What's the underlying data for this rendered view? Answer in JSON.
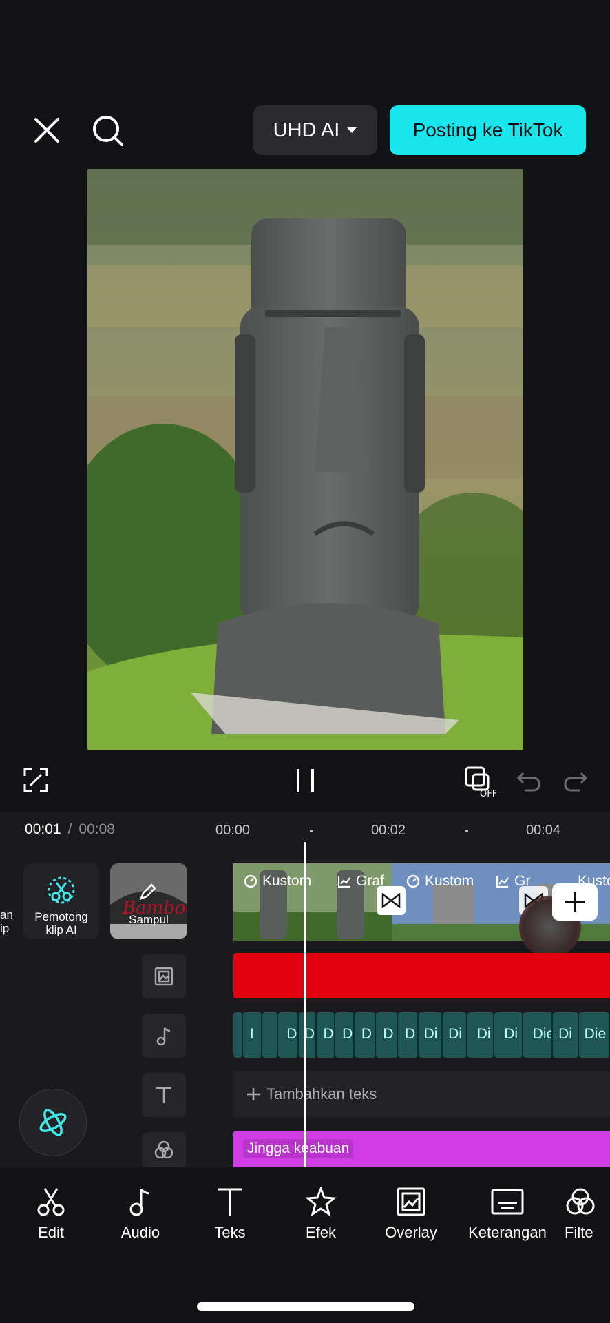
{
  "header": {
    "quality_label": "UHD AI",
    "post_label": "Posting ke TikTok"
  },
  "playback": {
    "current_time": "00:01",
    "separator": "/",
    "total_time": "00:08",
    "ticks": [
      "00:00",
      "00:02",
      "00:04"
    ]
  },
  "side_tools": {
    "partial_label_line1": "an",
    "partial_label_line2": "ip",
    "ai_cutter_label": "Pemotong\nklip AI",
    "cover_label": "Sampul",
    "cover_logo_text": "Bamboo"
  },
  "video_track": {
    "clips": [
      {
        "label": "Kustom",
        "label2": "Graf"
      },
      {
        "label": "Kustom",
        "label2": "Gr"
      },
      {
        "label": "Kusto"
      }
    ]
  },
  "audio_track": {
    "segments": [
      "I",
      "D",
      "D",
      "D",
      "D",
      "D",
      "D",
      "D",
      "Di",
      "Di",
      "Di",
      "Di",
      "Die",
      "Di",
      "Die"
    ]
  },
  "text_track": {
    "add_text_label": "Tambahkan teks"
  },
  "filter_track": {
    "label": "Jingga keabuan"
  },
  "toolbar": {
    "items": [
      {
        "label": "Edit",
        "icon": "scissors-icon"
      },
      {
        "label": "Audio",
        "icon": "music-note-icon"
      },
      {
        "label": "Teks",
        "icon": "text-icon"
      },
      {
        "label": "Efek",
        "icon": "star-icon"
      },
      {
        "label": "Overlay",
        "icon": "overlay-icon"
      },
      {
        "label": "Keterangan",
        "icon": "caption-icon"
      },
      {
        "label": "Filte",
        "icon": "filter-icon"
      }
    ]
  },
  "colors": {
    "accent_cyan": "#19e5ec",
    "audio_red": "#e3000f",
    "filter_magenta": "#d23ce6"
  }
}
